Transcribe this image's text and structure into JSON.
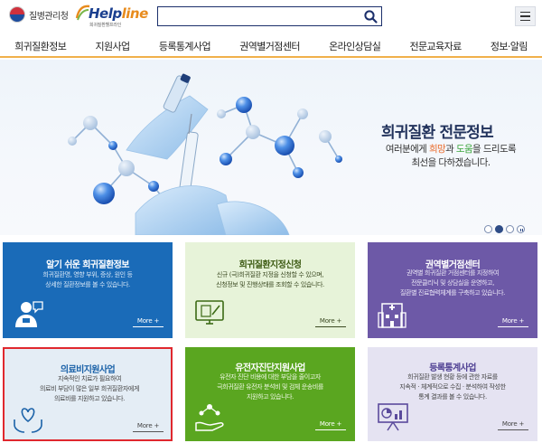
{
  "header": {
    "agency_name": "질병관리청",
    "helpline_title_a": "Help",
    "helpline_title_b": "line",
    "helpline_sub": "희귀질환헬프라인",
    "search": {
      "value": "",
      "placeholder": ""
    },
    "icons": {
      "search": "search-icon",
      "menu": "hamburger-menu-icon"
    }
  },
  "nav": {
    "items": [
      {
        "label": "희귀질환정보"
      },
      {
        "label": "지원사업"
      },
      {
        "label": "등록통계사업"
      },
      {
        "label": "권역별거점센터"
      },
      {
        "label": "온라인상담실"
      },
      {
        "label": "전문교육자료"
      },
      {
        "label": "정보·알림"
      }
    ]
  },
  "hero": {
    "title": "희귀질환 전문정보",
    "line1_a": "여러분에게 ",
    "line1_hope": "희망",
    "line1_mid": "과 ",
    "line1_help": "도움",
    "line1_b": "을 드리도록",
    "line2": "최선을 다하겠습니다.",
    "slides_total": 3,
    "slide_current": 2
  },
  "cards": [
    {
      "title": "알기 쉬운 희귀질환정보",
      "desc1": "희귀질환명, 영향 부위, 증상, 원인 등",
      "desc2": "상세한 질환정보를 볼 수 있습니다.",
      "desc3": "",
      "more": "More +",
      "icon": "consultation-person-icon"
    },
    {
      "title": "희귀질환지정신청",
      "desc1": "신규 (극)희귀질환 지정을 신청할 수 있으며,",
      "desc2": "신청정보 및 진행상태를 조회할 수 있습니다.",
      "desc3": "",
      "more": "More +",
      "icon": "monitor-document-icon"
    },
    {
      "title": "권역별거점센터",
      "desc1": "권역별 희귀질환 거점센터를 지정하여",
      "desc2": "전문클리닉 및 상담실을 운영하고,",
      "desc3": "질환별 진료협력체계를 구축하고 있습니다.",
      "more": "More +",
      "icon": "hospital-building-icon"
    },
    {
      "title": "의료비지원사업",
      "desc1": "지속적인 치료가 필요하여",
      "desc2": "의료비 부담이 많은 일부 희귀질환자에게",
      "desc3": "의료비를 지원하고 있습니다.",
      "more": "More +",
      "icon": "hands-heart-icon"
    },
    {
      "title": "유전자진단지원사업",
      "desc1": "유전자 진단 비용에 대한 부담을 줄이고자",
      "desc2": "극희귀질환 유전자 분석비 및 검체 운송비를",
      "desc3": "지원하고 있습니다.",
      "more": "More +",
      "icon": "hand-molecule-icon"
    },
    {
      "title": "등록통계사업",
      "desc1": "희귀질환 발생 현황 등에 관한 자료를",
      "desc2": "지속적 · 체계적으로 수집 · 분석하여 작성한",
      "desc3": "통계 결과를 볼 수 있습니다.",
      "more": "More +",
      "icon": "presentation-chart-icon"
    }
  ],
  "colors": {
    "navy": "#1b2f6b",
    "nav_underline": "#f0b04a",
    "card_blue": "#1a6bb8",
    "card_lightgreen": "#e7f3d9",
    "card_purple": "#6d59a7",
    "card_lightblue": "#e4edf5",
    "card_green": "#5aa620",
    "card_lavender": "#e5e3f2",
    "highlight_border": "#e0282e"
  }
}
